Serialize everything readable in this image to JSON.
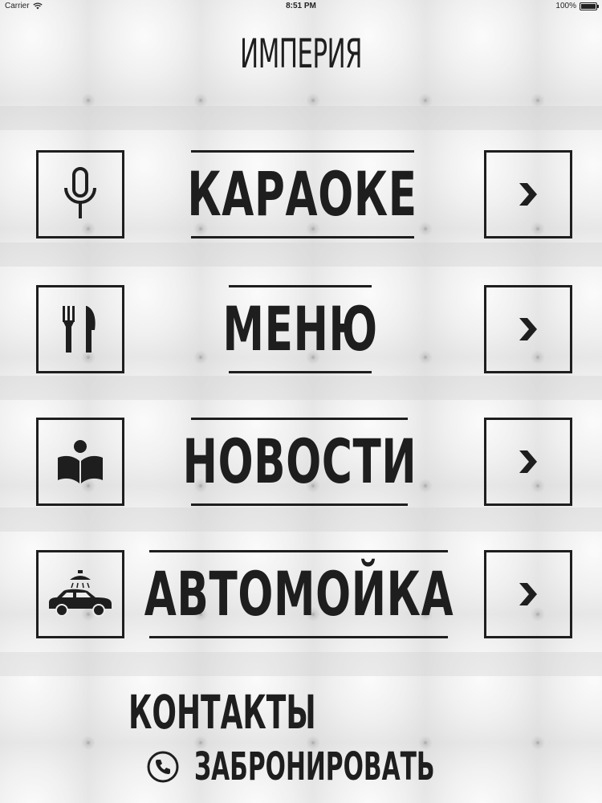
{
  "status_bar": {
    "carrier": "Carrier",
    "time": "8:51 PM",
    "battery": "100%"
  },
  "app": {
    "title": "ИМПЕРИЯ"
  },
  "menu": [
    {
      "label": "КАРАОКЕ",
      "icon": "microphone-icon"
    },
    {
      "label": "МЕНЮ",
      "icon": "fork-knife-icon"
    },
    {
      "label": "НОВОСТИ",
      "icon": "reader-icon"
    },
    {
      "label": "АВТОМОЙКА",
      "icon": "car-wash-icon"
    }
  ],
  "footer": {
    "contacts": "КОНТАКТЫ",
    "booking": "ЗАБРОНИРОВАТЬ"
  },
  "colors": {
    "ink": "#1e1e1e",
    "background": "#ececec"
  }
}
